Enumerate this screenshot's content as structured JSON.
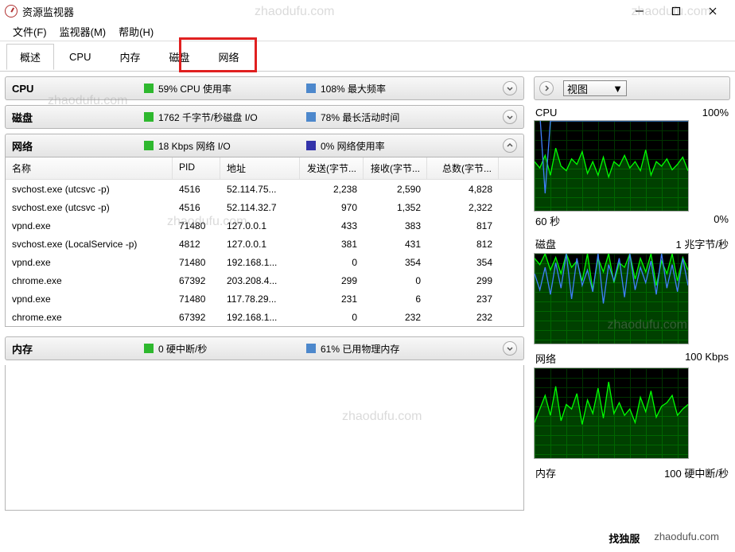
{
  "title": "资源监视器",
  "menu": {
    "file": "文件(F)",
    "monitor": "监视器(M)",
    "help": "帮助(H)"
  },
  "tabs": {
    "overview": "概述",
    "cpu": "CPU",
    "memory": "内存",
    "disk": "磁盘",
    "network": "网络"
  },
  "cpu_section": {
    "title": "CPU",
    "stat1": "59% CPU 使用率",
    "stat2": "108% 最大频率"
  },
  "disk_section": {
    "title": "磁盘",
    "stat1": "1762 千字节/秒磁盘 I/O",
    "stat2": "78% 最长活动时间"
  },
  "network_section": {
    "title": "网络",
    "stat1": "18 Kbps 网络 I/O",
    "stat2": "0% 网络使用率"
  },
  "memory_section": {
    "title": "内存",
    "stat1": "0 硬中断/秒",
    "stat2": "61% 已用物理内存"
  },
  "columns": {
    "name": "名称",
    "pid": "PID",
    "addr": "地址",
    "send": "发送(字节...",
    "recv": "接收(字节...",
    "total": "总数(字节..."
  },
  "rows": [
    {
      "name": "svchost.exe (utcsvc -p)",
      "pid": "4516",
      "addr": "52.114.75...",
      "send": "2,238",
      "recv": "2,590",
      "total": "4,828"
    },
    {
      "name": "svchost.exe (utcsvc -p)",
      "pid": "4516",
      "addr": "52.114.32.7",
      "send": "970",
      "recv": "1,352",
      "total": "2,322"
    },
    {
      "name": "vpnd.exe",
      "pid": "71480",
      "addr": "127.0.0.1",
      "send": "433",
      "recv": "383",
      "total": "817"
    },
    {
      "name": "svchost.exe (LocalService -p)",
      "pid": "4812",
      "addr": "127.0.0.1",
      "send": "381",
      "recv": "431",
      "total": "812"
    },
    {
      "name": "vpnd.exe",
      "pid": "71480",
      "addr": "192.168.1...",
      "send": "0",
      "recv": "354",
      "total": "354"
    },
    {
      "name": "chrome.exe",
      "pid": "67392",
      "addr": "203.208.4...",
      "send": "299",
      "recv": "0",
      "total": "299"
    },
    {
      "name": "vpnd.exe",
      "pid": "71480",
      "addr": "117.78.29...",
      "send": "231",
      "recv": "6",
      "total": "237"
    },
    {
      "name": "chrome.exe",
      "pid": "67392",
      "addr": "192.168.1...",
      "send": "0",
      "recv": "232",
      "total": "232"
    }
  ],
  "right": {
    "view_label": "视图",
    "cpu": {
      "title": "CPU",
      "right": "100%",
      "bottom_left": "60 秒",
      "bottom_right": "0%"
    },
    "disk": {
      "title": "磁盘",
      "right": "1 兆字节/秒"
    },
    "network": {
      "title": "网络",
      "right": "100 Kbps"
    },
    "memory": {
      "title": "内存",
      "right": "100 硬中断/秒"
    }
  },
  "watermark": "zhaodufu.com",
  "footer": {
    "brand": "找独服",
    "url": "zhaodufu.com"
  },
  "chart_data": [
    {
      "type": "line",
      "title": "CPU",
      "ylim": [
        0,
        100
      ],
      "xlabel": "60 秒",
      "series": [
        {
          "name": "usage",
          "color": "#00ff00",
          "values": [
            55,
            48,
            62,
            40,
            70,
            50,
            45,
            58,
            52,
            66,
            42,
            55,
            40,
            60,
            38,
            55,
            50,
            62,
            48,
            55,
            45,
            68,
            40,
            55,
            50,
            58,
            46,
            52,
            60,
            45
          ]
        },
        {
          "name": "max_freq",
          "color": "#4080ff",
          "values": [
            108,
            108,
            20,
            100,
            100,
            100,
            100,
            100,
            100,
            100,
            100,
            100,
            100,
            100,
            100,
            100,
            100,
            100,
            100,
            100,
            100,
            100,
            100,
            100,
            100,
            100,
            100,
            100,
            100,
            100
          ]
        }
      ]
    },
    {
      "type": "line",
      "title": "磁盘",
      "ylim": [
        0,
        100
      ],
      "series": [
        {
          "name": "io",
          "color": "#00ff00",
          "values": [
            95,
            88,
            100,
            82,
            96,
            78,
            100,
            85,
            92,
            70,
            100,
            60,
            95,
            80,
            100,
            68,
            90,
            85,
            100,
            72,
            95,
            80,
            100,
            65,
            92,
            78,
            100,
            70,
            96,
            82
          ]
        },
        {
          "name": "active",
          "color": "#4080ff",
          "values": [
            78,
            60,
            85,
            55,
            90,
            62,
            100,
            50,
            95,
            65,
            82,
            58,
            100,
            45,
            88,
            70,
            95,
            52,
            100,
            60,
            85,
            68,
            92,
            55,
            100,
            62,
            88,
            58,
            95,
            65
          ]
        }
      ]
    },
    {
      "type": "line",
      "title": "网络",
      "ylim": [
        0,
        100
      ],
      "series": [
        {
          "name": "io",
          "color": "#00ff00",
          "values": [
            40,
            55,
            70,
            48,
            80,
            42,
            60,
            55,
            72,
            38,
            65,
            50,
            78,
            45,
            85,
            50,
            62,
            48,
            55,
            40,
            68,
            52,
            75,
            46,
            58,
            62,
            70,
            48,
            55,
            60
          ]
        }
      ]
    }
  ]
}
